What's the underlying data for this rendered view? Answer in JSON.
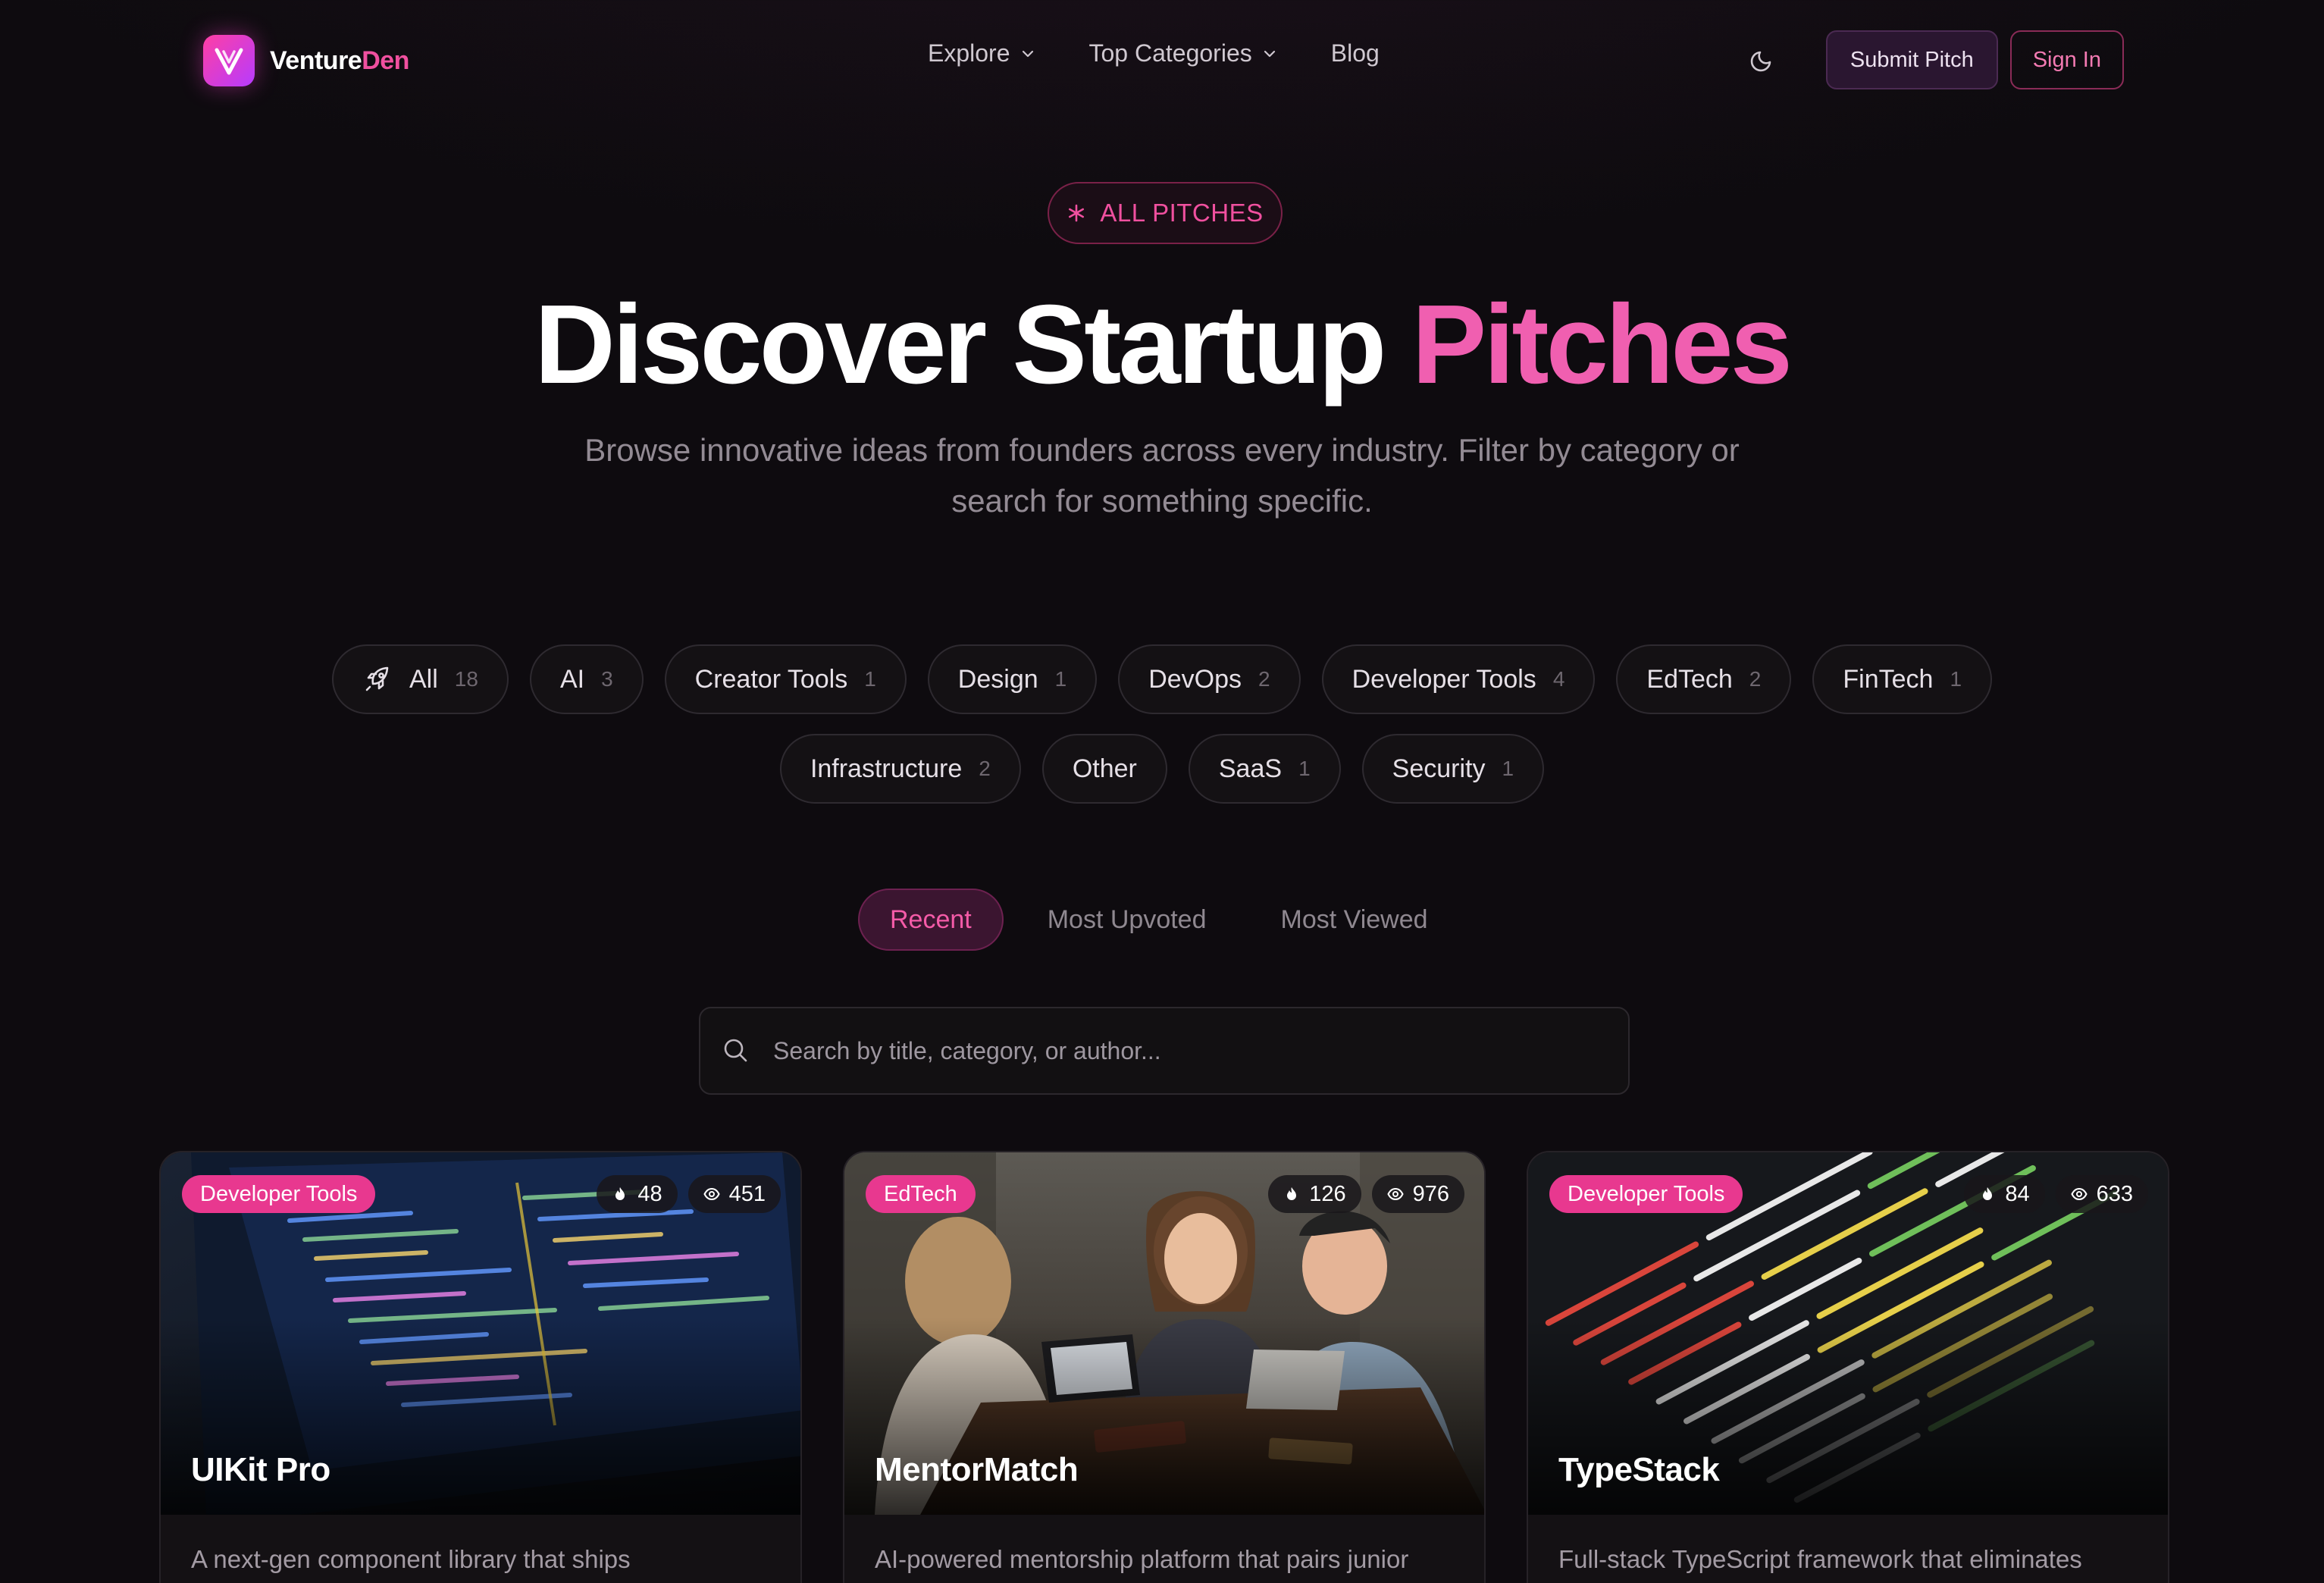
{
  "brand": {
    "name_prefix": "Venture",
    "name_suffix": "Den",
    "accent": "#f0509f"
  },
  "nav": {
    "links": [
      {
        "label": "Explore",
        "has_dropdown": true
      },
      {
        "label": "Top Categories",
        "has_dropdown": true
      },
      {
        "label": "Blog",
        "has_dropdown": false
      }
    ],
    "theme_toggle_icon": "moon-icon",
    "submit_label": "Submit Pitch",
    "signin_label": "Sign In"
  },
  "hero": {
    "badge": "ALL PITCHES",
    "title_main": "Discover Startup ",
    "title_accent": "Pitches",
    "subtitle_line1": "Browse innovative ideas from founders across every industry. Filter by category or",
    "subtitle_line2": "search for something specific."
  },
  "categories": [
    {
      "label": "All",
      "count": "18",
      "icon": "rocket-icon"
    },
    {
      "label": "AI",
      "count": "3"
    },
    {
      "label": "Creator Tools",
      "count": "1"
    },
    {
      "label": "Design",
      "count": "1"
    },
    {
      "label": "DevOps",
      "count": "2"
    },
    {
      "label": "Developer Tools",
      "count": "4"
    },
    {
      "label": "EdTech",
      "count": "2"
    },
    {
      "label": "FinTech",
      "count": "1"
    },
    {
      "label": "Infrastructure",
      "count": "2"
    },
    {
      "label": "Other",
      "count": ""
    },
    {
      "label": "SaaS",
      "count": "1"
    },
    {
      "label": "Security",
      "count": "1"
    }
  ],
  "sort_tabs": [
    {
      "label": "Recent",
      "active": true
    },
    {
      "label": "Most Upvoted",
      "active": false
    },
    {
      "label": "Most Viewed",
      "active": false
    }
  ],
  "search": {
    "placeholder": "Search by title, category, or author..."
  },
  "cards": [
    {
      "tag": "Developer Tools",
      "upvotes": "48",
      "views": "451",
      "title": "UIKit Pro",
      "description": "A next-gen component library that ships"
    },
    {
      "tag": "EdTech",
      "upvotes": "126",
      "views": "976",
      "title": "MentorMatch",
      "description": "AI-powered mentorship platform that pairs junior"
    },
    {
      "tag": "Developer Tools",
      "upvotes": "84",
      "views": "633",
      "title": "TypeStack",
      "description": "Full-stack TypeScript framework that eliminates"
    }
  ]
}
